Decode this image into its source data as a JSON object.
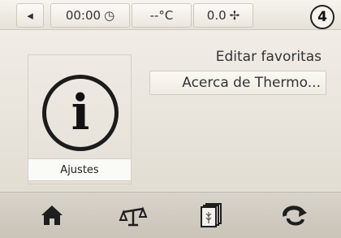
{
  "status_bar": {
    "back_icon": "left-arrow-icon",
    "time": "00:00",
    "time_icon": "clock-icon",
    "temperature": "--°C",
    "fan_speed": "0.0",
    "fan_icon": "fan-icon",
    "step_number": "4"
  },
  "main": {
    "tile": {
      "icon": "info-icon",
      "label": "Ajustes"
    },
    "menu": [
      {
        "label": "Editar favoritas",
        "selected": false
      },
      {
        "label": "Acerca de Thermo...",
        "selected": true
      }
    ]
  },
  "bottom_nav": [
    {
      "icon": "home-icon"
    },
    {
      "icon": "scale-icon"
    },
    {
      "icon": "recipes-icon"
    },
    {
      "icon": "reverse-icon"
    }
  ],
  "colors": {
    "background": "#e9e4dc",
    "bar": "#d0cac0"
  }
}
